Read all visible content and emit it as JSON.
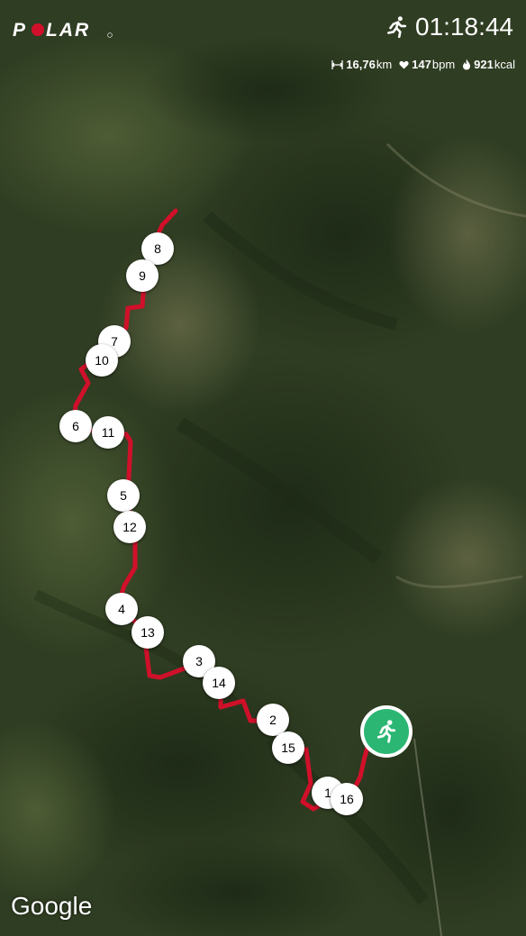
{
  "brand": {
    "name": "POLAR"
  },
  "header": {
    "activity_icon": "running-icon",
    "duration": "01:18:44",
    "distance_value": "16,76",
    "distance_unit": "km",
    "distance_icon": "distance-icon",
    "heart_rate_value": "147",
    "heart_rate_unit": "bpm",
    "heart_icon": "heart-icon",
    "calories_value": "921",
    "calories_unit": "kcal",
    "flame_icon": "flame-icon"
  },
  "map": {
    "attribution": "Google",
    "route_color": "#d0102a",
    "laps": [
      {
        "label": "8"
      },
      {
        "label": "9"
      },
      {
        "label": "7"
      },
      {
        "label": "10"
      },
      {
        "label": "6"
      },
      {
        "label": "11"
      },
      {
        "label": "5"
      },
      {
        "label": "12"
      },
      {
        "label": "4"
      },
      {
        "label": "13"
      },
      {
        "label": "3"
      },
      {
        "label": "14"
      },
      {
        "label": "2"
      },
      {
        "label": "15"
      },
      {
        "label": "1"
      },
      {
        "label": "16"
      }
    ],
    "current_position_icon": "runner-icon",
    "current_position_color": "#2bb673"
  }
}
